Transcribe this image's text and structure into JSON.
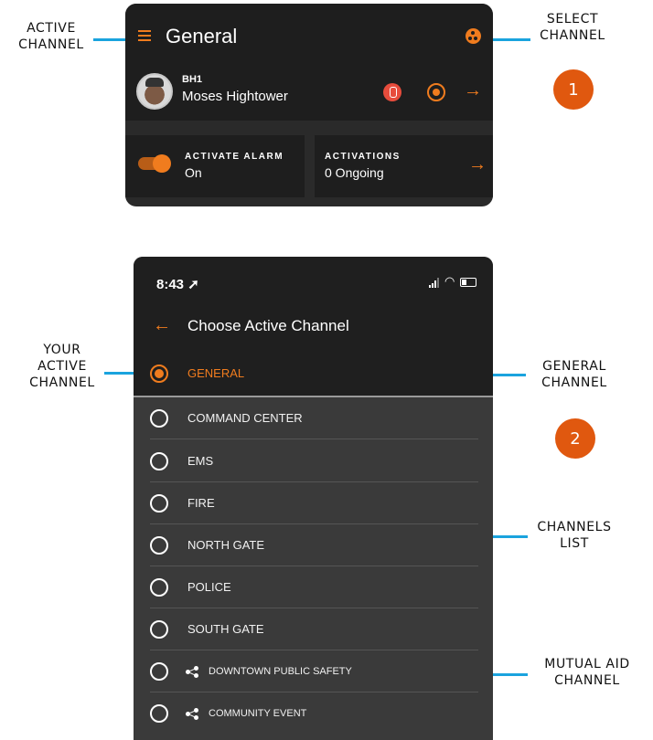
{
  "annotations": {
    "active_channel": [
      "ACTIVE",
      "CHANNEL"
    ],
    "select_channel": [
      "SELECT",
      "CHANNEL"
    ],
    "your_active_channel": [
      "YOUR",
      "ACTIVE",
      "CHANNEL"
    ],
    "general_channel": [
      "GENERAL",
      "CHANNEL"
    ],
    "channels_list": [
      "CHANNELS",
      "LIST"
    ],
    "mutual_aid_channel": [
      "MUTUAL AID",
      "CHANNEL"
    ],
    "badge1": "1",
    "badge2": "2"
  },
  "screen1": {
    "title": "General",
    "user_id": "BH1",
    "user_name": "Moses Hightower",
    "arrow": "→",
    "alarm_caption": "ACTIVATE ALARM",
    "alarm_value": "On",
    "activations_caption": "ACTIVATIONS",
    "activations_value": "0 Ongoing",
    "icons": [
      "menu-icon",
      "channel-select-icon",
      "medal-icon",
      "target-icon",
      "arrow-right-icon"
    ],
    "accent_color": "#f07c1e"
  },
  "screen2": {
    "status_time": "8:43",
    "title": "Choose Active Channel",
    "back": "←",
    "channels": [
      {
        "label": "GENERAL",
        "selected": true,
        "shared": false
      },
      {
        "label": "COMMAND CENTER",
        "selected": false,
        "shared": false
      },
      {
        "label": "EMS",
        "selected": false,
        "shared": false
      },
      {
        "label": "FIRE",
        "selected": false,
        "shared": false
      },
      {
        "label": "NORTH GATE",
        "selected": false,
        "shared": false
      },
      {
        "label": "POLICE",
        "selected": false,
        "shared": false
      },
      {
        "label": "SOUTH GATE",
        "selected": false,
        "shared": false
      },
      {
        "label": "DOWNTOWN PUBLIC SAFETY",
        "selected": false,
        "shared": true
      },
      {
        "label": "COMMUNITY EVENT",
        "selected": false,
        "shared": true
      }
    ]
  }
}
